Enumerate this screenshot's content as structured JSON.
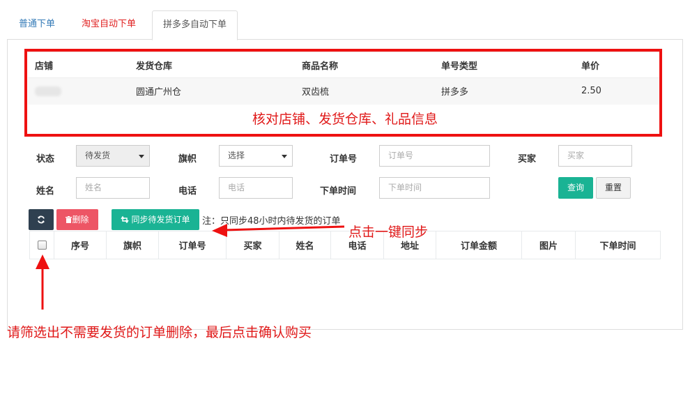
{
  "tabs": [
    {
      "label": "普通下单",
      "color": "#337ab7"
    },
    {
      "label": "淘宝自动下单",
      "color": "#e02020"
    },
    {
      "label": "拼多多自动下单",
      "active": true
    }
  ],
  "info_table": {
    "headers": [
      "店铺",
      "发货仓库",
      "商品名称",
      "单号类型",
      "单价"
    ],
    "row": {
      "shop": "",
      "warehouse": "圆通广州仓",
      "product": "双齿梳",
      "tracking_type": "拼多多",
      "price": "2.50"
    }
  },
  "info_note": "核对店铺、发货仓库、礼品信息",
  "filters": {
    "status_label": "状态",
    "status_value": "待发货",
    "flag_label": "旗帜",
    "flag_value": "选择",
    "order_no_label": "订单号",
    "order_no_placeholder": "订单号",
    "buyer_label": "买家",
    "buyer_placeholder": "买家",
    "name_label": "姓名",
    "name_placeholder": "姓名",
    "phone_label": "电话",
    "phone_placeholder": "电话",
    "order_time_label": "下单时间",
    "order_time_placeholder": "下单时间"
  },
  "buttons": {
    "query": "查询",
    "reset": "重置",
    "delete": "删除",
    "sync": "同步待发货订单"
  },
  "sync_note": "注：只同步48小时内待发货的订单",
  "order_table_headers": [
    "序号",
    "旗帜",
    "订单号",
    "买家",
    "姓名",
    "电话",
    "地址",
    "订单金额",
    "图片",
    "下单时间"
  ],
  "annotations": {
    "sync_hint": "点击一键同步",
    "delete_hint": "请筛选出不需要发货的订单删除，最后点击确认购买"
  },
  "colors": {
    "annotation_red": "#e01818",
    "teal": "#1ab394",
    "dark": "#2f4050",
    "delete_red": "#ed5565"
  },
  "icons": [
    "refresh-icon",
    "trash-icon",
    "sync-icon",
    "caret-down-icon",
    "arrow-left-icon",
    "arrow-up-icon"
  ]
}
